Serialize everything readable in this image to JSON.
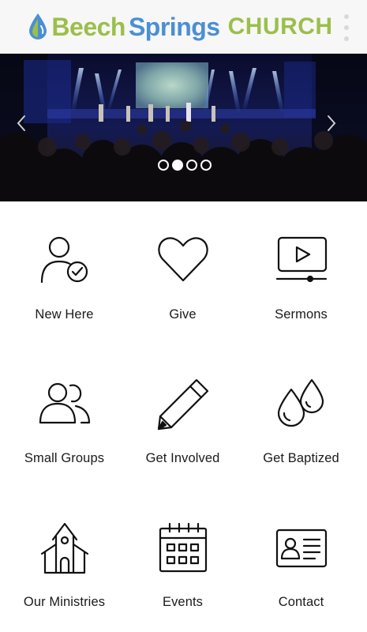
{
  "header": {
    "logo": {
      "part1": "Beech",
      "part2": "Springs",
      "part3": "CHURCH"
    },
    "menu_icon": "more-vertical-icon",
    "colors": {
      "green": "#9bbf4a",
      "blue": "#4a8fd4"
    }
  },
  "carousel": {
    "prev_icon": "chevron-left-icon",
    "next_icon": "chevron-right-icon",
    "slide_count": 4,
    "active_slide": 2
  },
  "tiles": [
    {
      "label": "New Here",
      "icon": "user-check-icon"
    },
    {
      "label": "Give",
      "icon": "heart-icon"
    },
    {
      "label": "Sermons",
      "icon": "video-play-icon"
    },
    {
      "label": "Small Groups",
      "icon": "users-icon"
    },
    {
      "label": "Get Involved",
      "icon": "pencil-icon"
    },
    {
      "label": "Get Baptized",
      "icon": "water-drops-icon"
    },
    {
      "label": "Our Ministries",
      "icon": "church-building-icon"
    },
    {
      "label": "Events",
      "icon": "calendar-icon"
    },
    {
      "label": "Contact",
      "icon": "contact-card-icon"
    }
  ]
}
